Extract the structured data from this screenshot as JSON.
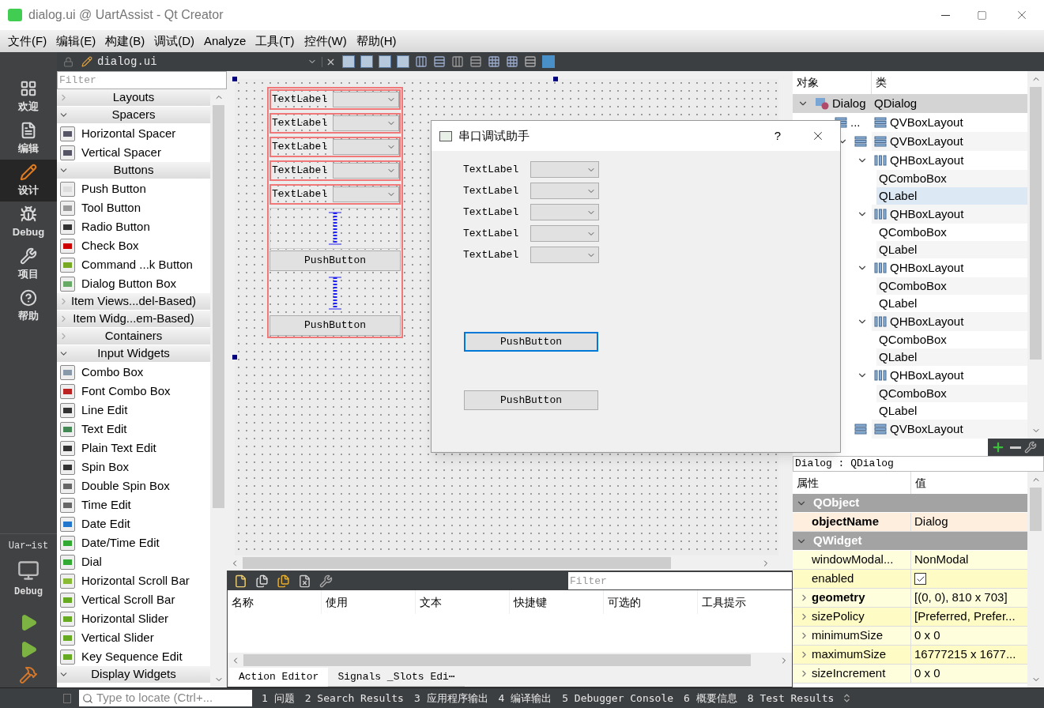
{
  "window": {
    "title": "dialog.ui @ UartAssist - Qt Creator"
  },
  "menu": [
    "文件(F)",
    "编辑(E)",
    "构建(B)",
    "调试(D)",
    "Analyze",
    "工具(T)",
    "控件(W)",
    "帮助(H)"
  ],
  "modes": [
    {
      "label": "欢迎",
      "selected": false
    },
    {
      "label": "编辑",
      "selected": false
    },
    {
      "label": "设计",
      "selected": true
    },
    {
      "label": "Debug",
      "selected": false
    },
    {
      "label": "项目",
      "selected": false
    },
    {
      "label": "帮助",
      "selected": false
    }
  ],
  "run_target": {
    "project": "Uar⋯ist",
    "config": "Debug"
  },
  "editor_tab": {
    "file": "dialog.ui"
  },
  "widget_box": {
    "filter_placeholder": "Filter",
    "items": [
      {
        "kind": "category",
        "label": "Layouts",
        "expanded": false
      },
      {
        "kind": "category",
        "label": "Spacers",
        "expanded": true
      },
      {
        "kind": "widget",
        "label": "Horizontal Spacer"
      },
      {
        "kind": "widget",
        "label": "Vertical Spacer"
      },
      {
        "kind": "category",
        "label": "Buttons",
        "expanded": true
      },
      {
        "kind": "widget",
        "label": "Push Button"
      },
      {
        "kind": "widget",
        "label": "Tool Button"
      },
      {
        "kind": "widget",
        "label": "Radio Button"
      },
      {
        "kind": "widget",
        "label": "Check Box"
      },
      {
        "kind": "widget",
        "label": "Command ...k Button"
      },
      {
        "kind": "widget",
        "label": "Dialog Button Box"
      },
      {
        "kind": "category",
        "label": "Item Views...del-Based)",
        "expanded": false
      },
      {
        "kind": "category",
        "label": "Item Widg...em-Based)",
        "expanded": false
      },
      {
        "kind": "category",
        "label": "Containers",
        "expanded": false
      },
      {
        "kind": "category",
        "label": "Input Widgets",
        "expanded": true
      },
      {
        "kind": "widget",
        "label": "Combo Box"
      },
      {
        "kind": "widget",
        "label": "Font Combo Box"
      },
      {
        "kind": "widget",
        "label": "Line Edit"
      },
      {
        "kind": "widget",
        "label": "Text Edit"
      },
      {
        "kind": "widget",
        "label": "Plain Text Edit"
      },
      {
        "kind": "widget",
        "label": "Spin Box"
      },
      {
        "kind": "widget",
        "label": "Double Spin Box"
      },
      {
        "kind": "widget",
        "label": "Time Edit"
      },
      {
        "kind": "widget",
        "label": "Date Edit"
      },
      {
        "kind": "widget",
        "label": "Date/Time Edit"
      },
      {
        "kind": "widget",
        "label": "Dial"
      },
      {
        "kind": "widget",
        "label": "Horizontal Scroll Bar"
      },
      {
        "kind": "widget",
        "label": "Vertical Scroll Bar"
      },
      {
        "kind": "widget",
        "label": "Horizontal Slider"
      },
      {
        "kind": "widget",
        "label": "Vertical Slider"
      },
      {
        "kind": "widget",
        "label": "Key Sequence Edit"
      },
      {
        "kind": "category",
        "label": "Display Widgets",
        "expanded": true
      }
    ]
  },
  "form": {
    "rows": [
      "TextLabel",
      "TextLabel",
      "TextLabel",
      "TextLabel",
      "TextLabel"
    ],
    "buttons": [
      "PushButton",
      "PushButton"
    ]
  },
  "preview": {
    "title": "串口调试助手",
    "help": "?",
    "rows": [
      "TextLabel",
      "TextLabel",
      "TextLabel",
      "TextLabel",
      "TextLabel"
    ],
    "buttons": [
      {
        "label": "PushButton",
        "focused": true
      },
      {
        "label": "PushButton",
        "focused": false
      }
    ]
  },
  "object_inspector": {
    "columns": [
      "对象",
      "类"
    ],
    "tree": [
      {
        "kind": "dialog",
        "object": "Dialog",
        "class": "QDialog",
        "expanded": true,
        "selected": true,
        "hovered": false,
        "children": [
          {
            "kind": "vbox",
            "object": "...",
            "class": "QVBoxLayout",
            "expanded": true,
            "selected": false,
            "hovered": false,
            "children": [
              {
                "kind": "vbox",
                "class": "QVBoxLayout",
                "expanded": true,
                "selected": false,
                "hovered": false,
                "children": [
                  {
                    "kind": "hbox",
                    "class": "QHBoxLayout",
                    "expanded": true,
                    "selected": false,
                    "hovered": false,
                    "children": [
                      {
                        "kind": "widget",
                        "class": "QComboBox",
                        "expanded": false,
                        "selected": false,
                        "hovered": false
                      },
                      {
                        "kind": "widget",
                        "class": "QLabel",
                        "expanded": false,
                        "selected": false,
                        "hovered": true
                      }
                    ]
                  },
                  {
                    "kind": "hbox",
                    "class": "QHBoxLayout",
                    "expanded": true,
                    "selected": false,
                    "hovered": false,
                    "children": [
                      {
                        "kind": "widget",
                        "class": "QComboBox",
                        "expanded": false,
                        "selected": false,
                        "hovered": false
                      },
                      {
                        "kind": "widget",
                        "class": "QLabel",
                        "expanded": false,
                        "selected": false,
                        "hovered": false
                      }
                    ]
                  },
                  {
                    "kind": "hbox",
                    "class": "QHBoxLayout",
                    "expanded": true,
                    "selected": false,
                    "hovered": false,
                    "children": [
                      {
                        "kind": "widget",
                        "class": "QComboBox",
                        "expanded": false,
                        "selected": false,
                        "hovered": false
                      },
                      {
                        "kind": "widget",
                        "class": "QLabel",
                        "expanded": false,
                        "selected": false,
                        "hovered": false
                      }
                    ]
                  },
                  {
                    "kind": "hbox",
                    "class": "QHBoxLayout",
                    "expanded": true,
                    "selected": false,
                    "hovered": false,
                    "children": [
                      {
                        "kind": "widget",
                        "class": "QComboBox",
                        "expanded": false,
                        "selected": false,
                        "hovered": false
                      },
                      {
                        "kind": "widget",
                        "class": "QLabel",
                        "expanded": false,
                        "selected": false,
                        "hovered": false
                      }
                    ]
                  },
                  {
                    "kind": "hbox",
                    "class": "QHBoxLayout",
                    "expanded": true,
                    "selected": false,
                    "hovered": false,
                    "children": [
                      {
                        "kind": "widget",
                        "class": "QComboBox",
                        "expanded": false,
                        "selected": false,
                        "hovered": false
                      },
                      {
                        "kind": "widget",
                        "class": "QLabel",
                        "expanded": false,
                        "selected": false,
                        "hovered": false
                      }
                    ]
                  }
                ]
              },
              {
                "kind": "vbox",
                "class": "QVBoxLayout",
                "expanded": true,
                "selected": false,
                "hovered": false
              }
            ]
          }
        ]
      }
    ]
  },
  "property_editor": {
    "title": "Dialog : QDialog",
    "columns": [
      "属性",
      "值"
    ],
    "groups": [
      {
        "name": "QObject",
        "expanded": true,
        "rows": [
          {
            "kind": "text",
            "name": "objectName",
            "value": "Dialog",
            "modified": true,
            "expandable": false
          }
        ]
      },
      {
        "name": "QWidget",
        "expanded": true,
        "rows": [
          {
            "kind": "text",
            "name": "windowModal...",
            "value": "NonModal",
            "modified": false,
            "expandable": false
          },
          {
            "kind": "checkbox",
            "name": "enabled",
            "checked": true,
            "modified": false,
            "expandable": false
          },
          {
            "kind": "text",
            "name": "geometry",
            "value": "[(0, 0), 810 x 703]",
            "modified": true,
            "expandable": true
          },
          {
            "kind": "text",
            "name": "sizePolicy",
            "value": "[Preferred, Prefer...",
            "modified": false,
            "expandable": true
          },
          {
            "kind": "text",
            "name": "minimumSize",
            "value": "0 x 0",
            "modified": false,
            "expandable": true
          },
          {
            "kind": "text",
            "name": "maximumSize",
            "value": "16777215 x 1677...",
            "modified": false,
            "expandable": true
          },
          {
            "kind": "text",
            "name": "sizeIncrement",
            "value": "0 x 0",
            "modified": false,
            "expandable": true
          }
        ]
      }
    ]
  },
  "action_editor": {
    "filter_placeholder": "Filter",
    "columns": [
      "名称",
      "使用",
      "文本",
      "快捷键",
      "可选的",
      "工具提示"
    ],
    "tabs": [
      {
        "label": "Action Editor",
        "selected": true
      },
      {
        "label": "Signals _Slots Edi⋯",
        "selected": false
      }
    ]
  },
  "status_bar": {
    "locator_placeholder": "Type to locate (Ctrl+...",
    "panes": [
      "1 问题",
      "2 Search Results",
      "3 应用程序输出",
      "4 编译输出",
      "5 Debugger Console",
      "6 概要信息",
      "8 Test Results"
    ]
  }
}
